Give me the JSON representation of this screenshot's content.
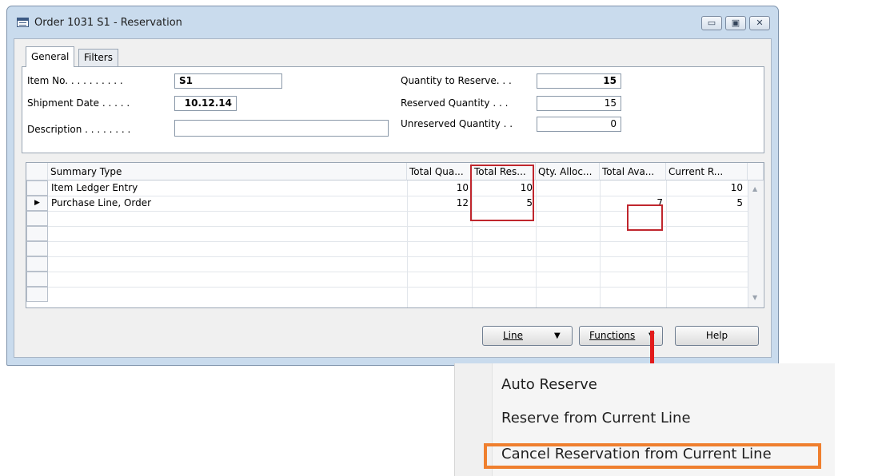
{
  "window": {
    "title": "Order 1031 S1 - Reservation",
    "controls": {
      "minimize": "▭",
      "restore": "▣",
      "close": "✕"
    }
  },
  "tabs": [
    "General",
    "Filters"
  ],
  "general": {
    "item_no_label": "Item No. . . . . . . . . .",
    "item_no_value": "S1",
    "shipment_date_label": "Shipment Date . . . . .",
    "shipment_date_value": "10.12.14",
    "description_label": "Description . . . . . . . .",
    "description_value": "",
    "qty_to_reserve_label": "Quantity to Reserve. . .",
    "qty_to_reserve_value": "15",
    "reserved_qty_label": "Reserved Quantity . . .",
    "reserved_qty_value": "15",
    "unreserved_qty_label": "Unreserved Quantity . .",
    "unreserved_qty_value": "0"
  },
  "grid": {
    "columns": [
      "Summary Type",
      "Total Qua...",
      "Total Res...",
      "Qty. Alloc...",
      "Total Ava...",
      "Current R..."
    ],
    "rows": [
      {
        "summary_type": "Item Ledger Entry",
        "total_qty": "10",
        "total_reserved": "10",
        "qty_alloc": "",
        "total_avail": "",
        "current_reserved": "10"
      },
      {
        "summary_type": "Purchase Line, Order",
        "total_qty": "12",
        "total_reserved": "5",
        "qty_alloc": "",
        "total_avail": "7",
        "current_reserved": "5"
      }
    ],
    "current_row_marker": "▶"
  },
  "buttons": {
    "line": "Line",
    "functions": "Functions",
    "help": "Help",
    "dropdown_glyph": "▼"
  },
  "menu": {
    "items": [
      "Auto Reserve",
      "Reserve from Current Line",
      "Cancel Reservation from Current Line"
    ]
  },
  "colors": {
    "highlight_red": "#c0262d",
    "menu_highlight_orange": "#ef7f2e",
    "arrow_red": "#e21b1b"
  }
}
